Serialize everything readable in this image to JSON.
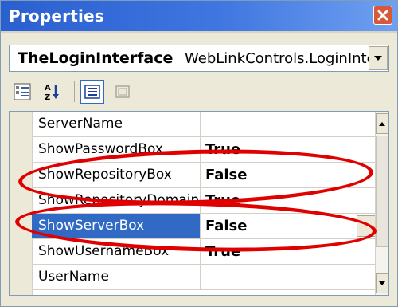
{
  "window": {
    "title": "Properties"
  },
  "object_selector": {
    "object_name": "TheLoginInterface",
    "object_type": "WebLinkControls.LoginInter"
  },
  "toolbar": {
    "buttons": [
      {
        "icon": "categorized-icon",
        "pressed": false
      },
      {
        "icon": "alphabetical-icon",
        "pressed": false
      },
      {
        "icon": "properties-icon",
        "pressed": true
      },
      {
        "icon": "property-pages-icon",
        "pressed": false,
        "disabled": true
      }
    ]
  },
  "properties": [
    {
      "name": "ServerName",
      "value": ""
    },
    {
      "name": "ShowPasswordBox",
      "value": "True"
    },
    {
      "name": "ShowRepositoryBox",
      "value": "False"
    },
    {
      "name": "ShowRepositoryDomain",
      "value": "True"
    },
    {
      "name": "ShowServerBox",
      "value": "False",
      "selected": true
    },
    {
      "name": "ShowUsernameBox",
      "value": "True"
    },
    {
      "name": "UserName",
      "value": ""
    }
  ],
  "colors": {
    "titlebar": "#2a5fd0",
    "selection": "#316ac5",
    "annotation": "#e00000"
  }
}
